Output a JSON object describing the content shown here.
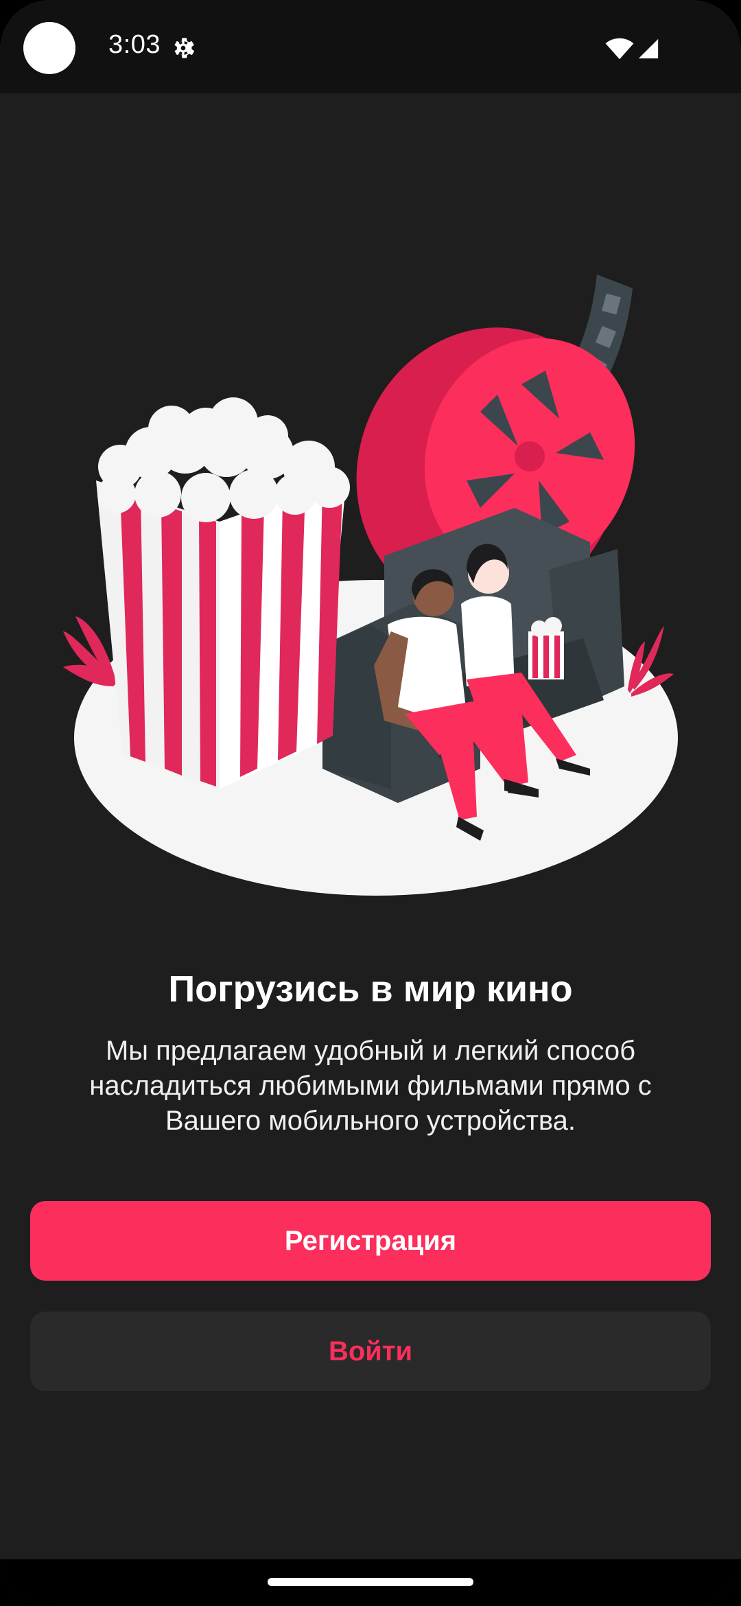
{
  "status_bar": {
    "time": "3:03",
    "icons": [
      "settings-icon",
      "wifi-icon",
      "signal-icon"
    ]
  },
  "onboarding": {
    "illustration": "cinema-couple-popcorn-film-reel-illustration",
    "title": "Погрузись в мир кино",
    "description": "Мы предлагаем удобный и легкий способ насладиться любимыми фильмами прямо с Вашего мобильного устройства."
  },
  "actions": {
    "register_label": "Регистрация",
    "login_label": "Войти"
  },
  "colors": {
    "accent": "#fc2e5c",
    "background": "#1e1e1e",
    "secondary_button": "#2a2a2a",
    "status_bar": "#111111"
  }
}
